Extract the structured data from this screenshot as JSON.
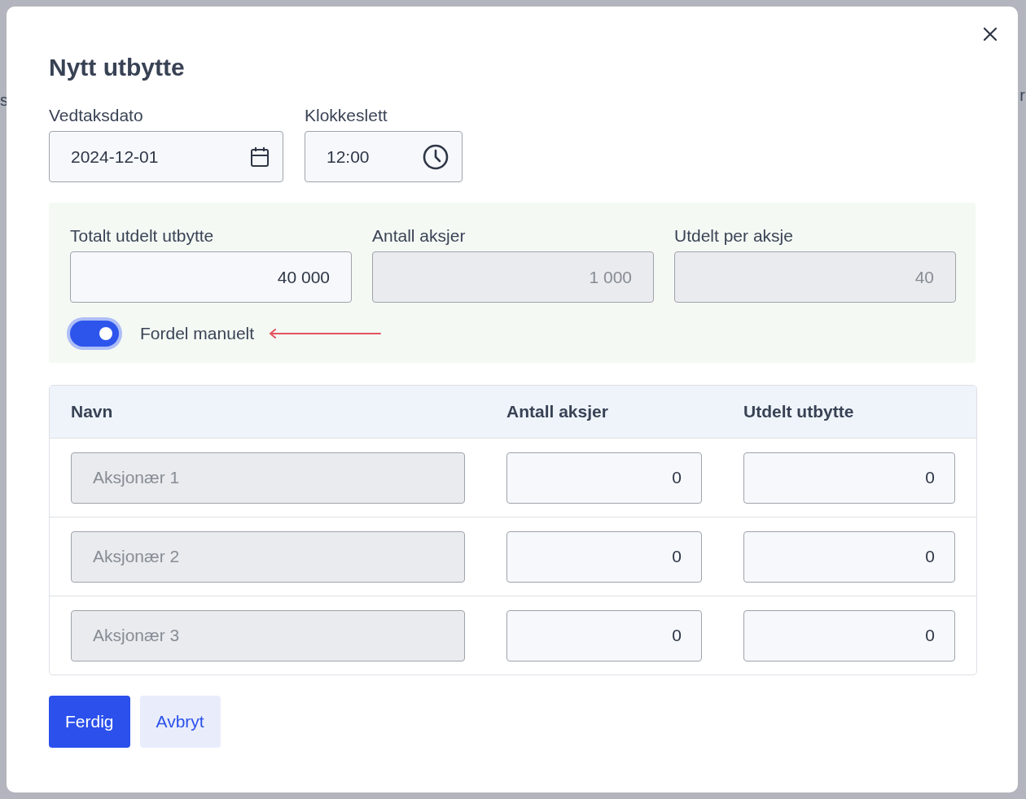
{
  "background": {
    "fragments": [
      "s",
      "r"
    ]
  },
  "dialog": {
    "title": "Nytt utbytte",
    "date": {
      "label": "Vedtaksdato",
      "value": "2024-12-01"
    },
    "time": {
      "label": "Klokkeslett",
      "value": "12:00"
    },
    "summary": {
      "fields": [
        {
          "label": "Totalt utdelt utbytte",
          "value": "40 000",
          "disabled": false
        },
        {
          "label": "Antall aksjer",
          "value": "1 000",
          "disabled": true
        },
        {
          "label": "Utdelt per aksje",
          "value": "40",
          "disabled": true
        }
      ],
      "toggle": {
        "label": "Fordel manuelt",
        "on": true
      }
    },
    "table": {
      "columns": [
        "Navn",
        "Antall aksjer",
        "Utdelt utbytte"
      ],
      "rows": [
        {
          "name": "Aksjonær 1",
          "shares": "0",
          "dividend": "0"
        },
        {
          "name": "Aksjonær 2",
          "shares": "0",
          "dividend": "0"
        },
        {
          "name": "Aksjonær 3",
          "shares": "0",
          "dividend": "0"
        }
      ]
    },
    "buttons": [
      {
        "label": "Ferdig",
        "kind": "primary"
      },
      {
        "label": "Avbryt",
        "kind": "secondary"
      }
    ]
  }
}
